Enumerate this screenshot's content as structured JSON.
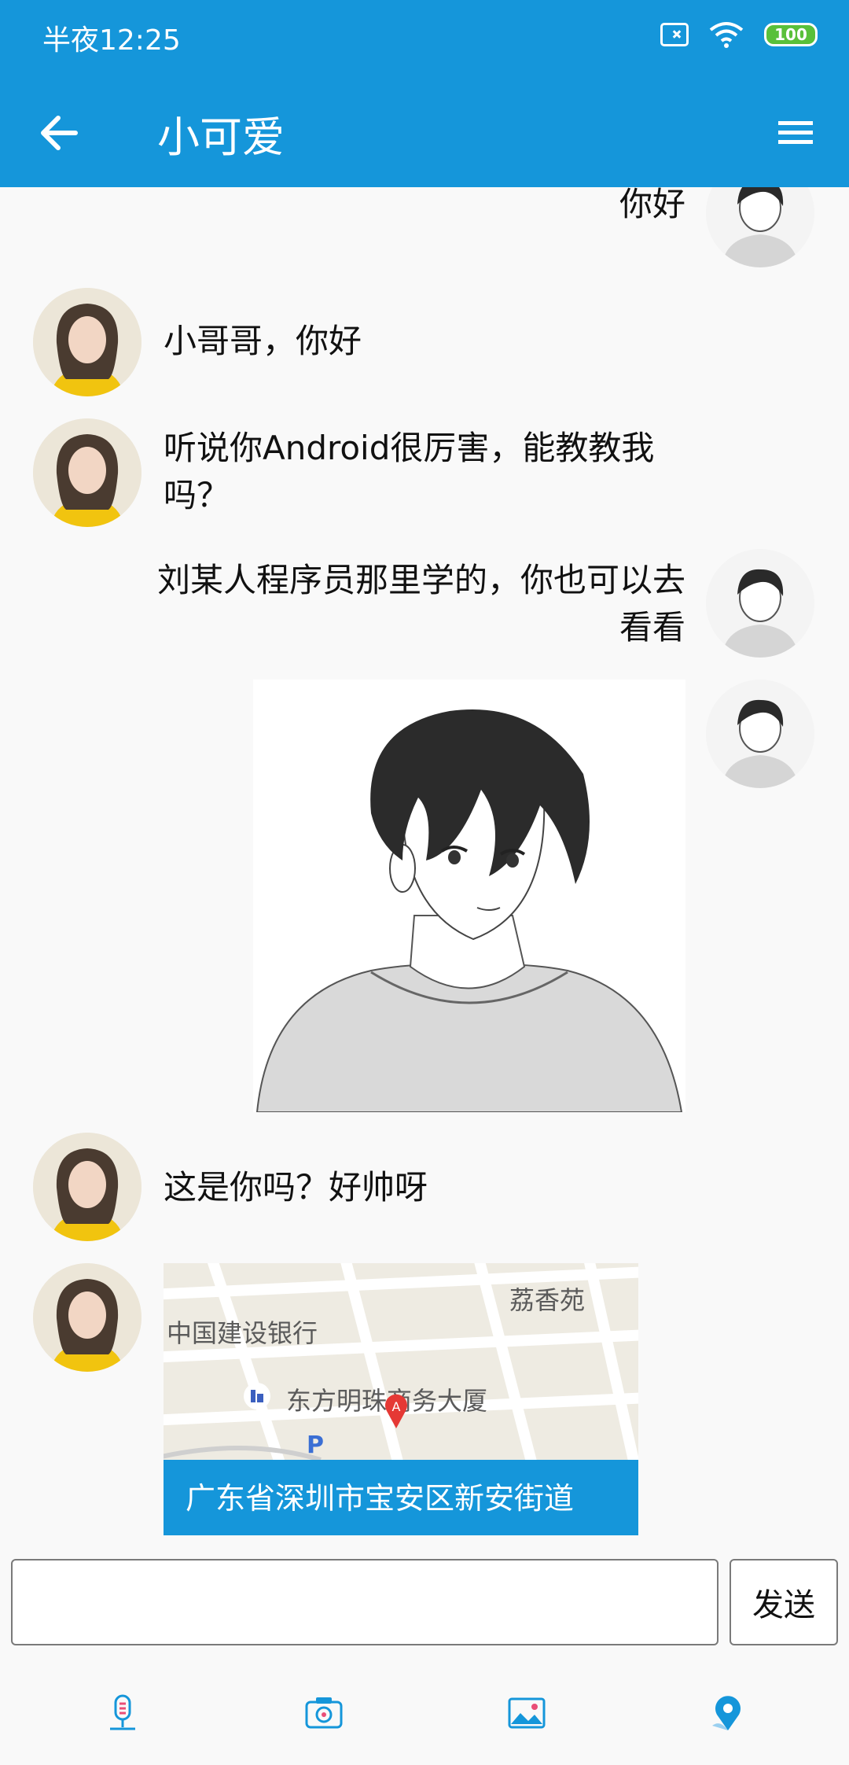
{
  "status_bar": {
    "time": "半夜12:25",
    "battery": "100"
  },
  "app_bar": {
    "title": "小可爱"
  },
  "messages": [
    {
      "side": "right",
      "text": "你好"
    },
    {
      "side": "left",
      "text": "小哥哥，你好"
    },
    {
      "side": "left",
      "text_line1": "听说你Android很厉害，能教教我",
      "text_line2": "吗？"
    },
    {
      "side": "right",
      "text_line1": "刘某人程序员那里学的，你也可以去",
      "text_line2": "看看"
    },
    {
      "side": "right",
      "type": "image",
      "image_desc": "anime-boy-sketch"
    },
    {
      "side": "left",
      "text": "这是你吗？好帅呀"
    },
    {
      "side": "left",
      "type": "location",
      "map_labels": [
        "荔香苑",
        "中国建设银行",
        "东方明珠商务大厦"
      ],
      "address": "广东省深圳市宝安区新安街道"
    }
  ],
  "input": {
    "value": "",
    "send_label": "发送"
  },
  "toolbar": {
    "icons": [
      "microphone-icon",
      "camera-icon",
      "image-icon",
      "location-icon"
    ]
  },
  "colors": {
    "primary": "#1596da",
    "background": "#f9f9f9"
  }
}
